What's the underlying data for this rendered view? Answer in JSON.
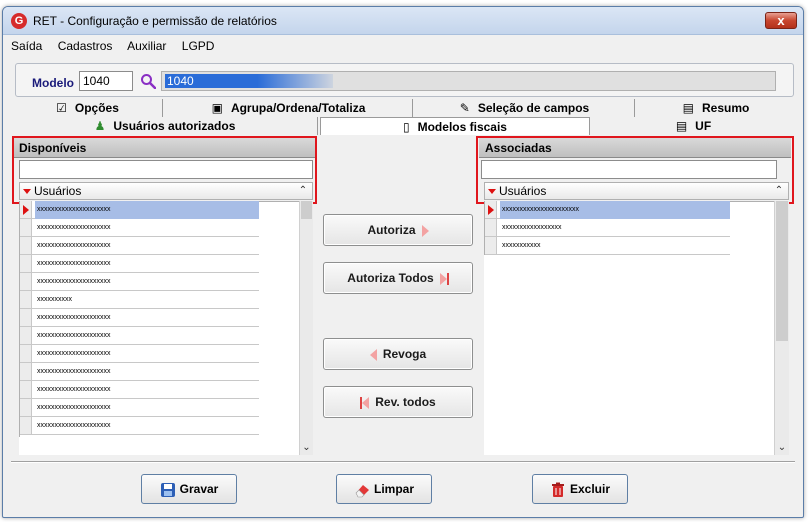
{
  "window": {
    "title": "RET - Configuração e permissão de relatórios",
    "close_label": "x"
  },
  "menu": [
    "Saída",
    "Cadastros",
    "Auxiliar",
    "LGPD"
  ],
  "model": {
    "label": "Modelo",
    "code": "1040",
    "name_selected": "1040"
  },
  "tabs_row1": [
    "Opções",
    "Agrupa/Ordena/Totaliza",
    "Seleção de campos",
    "Resumo"
  ],
  "tabs_row2": [
    "Usuários autorizados",
    "Modelos fiscais",
    "UF"
  ],
  "available": {
    "header": "Disponíveis",
    "filter_value": "",
    "column": "Usuários",
    "rows": [
      "xxxxxxxxxxxxxxxxxxxxx",
      "xxxxxxxxxxxxxxxxxxxxx",
      "xxxxxxxxxxxxxxxxxxxxx",
      "xxxxxxxxxxxxxxxxxxxxx",
      "xxxxxxxxxxxxxxxxxxxxx",
      "xxxxxxxxxx",
      "xxxxxxxxxxxxxxxxxxxxx",
      "xxxxxxxxxxxxxxxxxxxxx",
      "xxxxxxxxxxxxxxxxxxxxx",
      "xxxxxxxxxxxxxxxxxxxxx",
      "xxxxxxxxxxxxxxxxxxxxx",
      "xxxxxxxxxxxxxxxxxxxxx",
      "xxxxxxxxxxxxxxxxxxxxx"
    ]
  },
  "associated": {
    "header": "Associadas",
    "filter_value": "",
    "column": "Usuários",
    "rows": [
      "xxxxxxxxxxxxxxxxxxxxxx",
      "xxxxxxxxxxxxxxxxx",
      "xxxxxxxxxxx"
    ]
  },
  "actions": {
    "autoriza": "Autoriza",
    "autoriza_todos": "Autoriza Todos",
    "revoga": "Revoga",
    "rev_todos": "Rev. todos"
  },
  "footer": {
    "gravar": "Gravar",
    "limpar": "Limpar",
    "excluir": "Excluir"
  },
  "colors": {
    "highlight_box": "#e0161d",
    "selection": "#2a6cd8",
    "row_selected": "#a7bde6"
  }
}
